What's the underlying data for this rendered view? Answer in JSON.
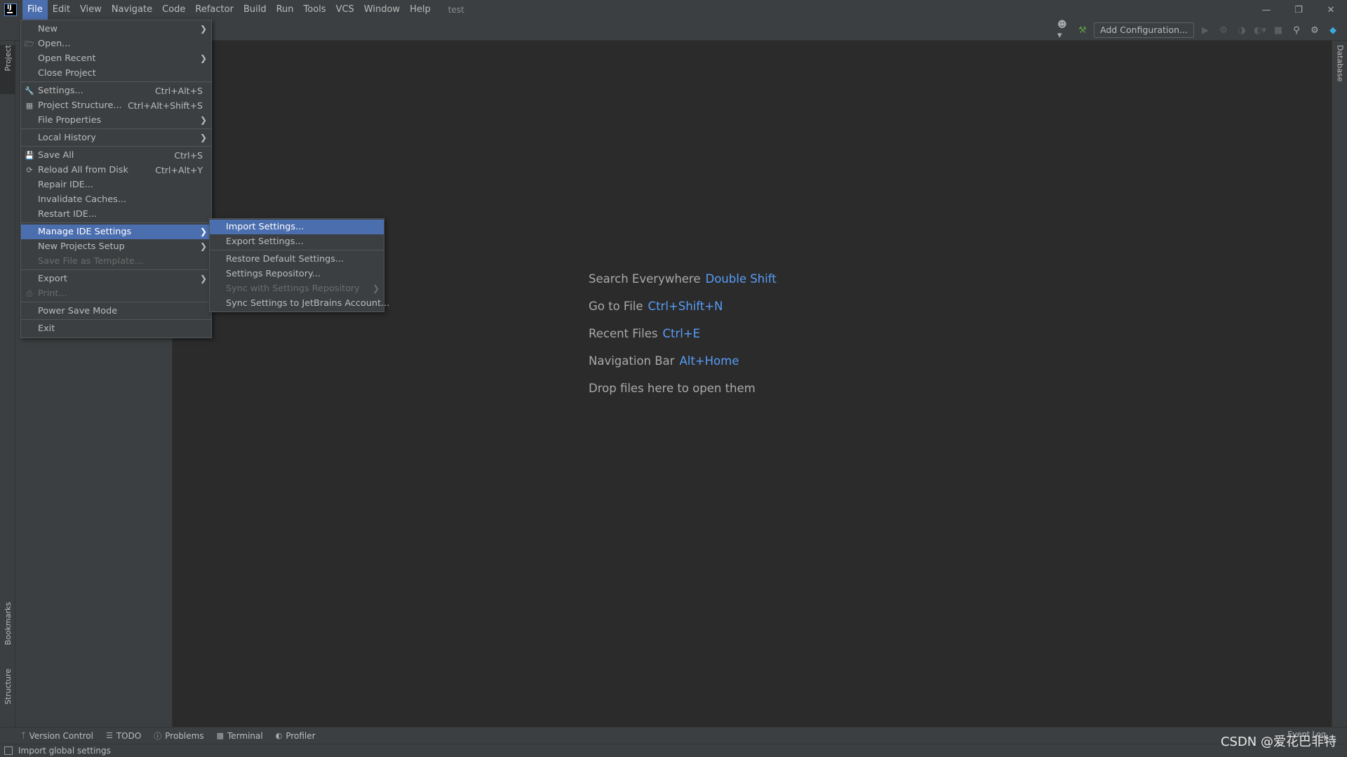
{
  "menubar": {
    "items": [
      "File",
      "Edit",
      "View",
      "Navigate",
      "Code",
      "Refactor",
      "Build",
      "Run",
      "Tools",
      "VCS",
      "Window",
      "Help"
    ],
    "project_name": "test"
  },
  "toolbar": {
    "add_configuration": "Add Configuration..."
  },
  "file_menu": {
    "items": [
      {
        "label": "New",
        "shortcut": "",
        "submenu": true
      },
      {
        "label": "Open...",
        "shortcut": ""
      },
      {
        "label": "Open Recent",
        "shortcut": "",
        "submenu": true
      },
      {
        "label": "Close Project",
        "shortcut": ""
      },
      {
        "label": "Settings...",
        "shortcut": "Ctrl+Alt+S"
      },
      {
        "label": "Project Structure...",
        "shortcut": "Ctrl+Alt+Shift+S"
      },
      {
        "label": "File Properties",
        "shortcut": "",
        "submenu": true
      },
      {
        "label": "Local History",
        "shortcut": "",
        "submenu": true
      },
      {
        "label": "Save All",
        "shortcut": "Ctrl+S"
      },
      {
        "label": "Reload All from Disk",
        "shortcut": "Ctrl+Alt+Y"
      },
      {
        "label": "Repair IDE...",
        "shortcut": ""
      },
      {
        "label": "Invalidate Caches...",
        "shortcut": ""
      },
      {
        "label": "Restart IDE...",
        "shortcut": ""
      },
      {
        "label": "Manage IDE Settings",
        "shortcut": "",
        "submenu": true,
        "highlighted": true
      },
      {
        "label": "New Projects Setup",
        "shortcut": "",
        "submenu": true
      },
      {
        "label": "Save File as Template...",
        "shortcut": "",
        "disabled": true
      },
      {
        "label": "Export",
        "shortcut": "",
        "submenu": true
      },
      {
        "label": "Print...",
        "shortcut": "",
        "disabled": true
      },
      {
        "label": "Power Save Mode",
        "shortcut": ""
      },
      {
        "label": "Exit",
        "shortcut": ""
      }
    ]
  },
  "manage_settings_submenu": {
    "items": [
      {
        "label": "Import Settings...",
        "highlighted": true
      },
      {
        "label": "Export Settings..."
      },
      {
        "label": "Restore Default Settings..."
      },
      {
        "label": "Settings Repository..."
      },
      {
        "label": "Sync with Settings Repository",
        "disabled": true
      },
      {
        "label": "Sync Settings to JetBrains Account..."
      }
    ]
  },
  "editor_hints": [
    {
      "text": "Search Everywhere",
      "key": "Double Shift"
    },
    {
      "text": "Go to File",
      "key": "Ctrl+Shift+N"
    },
    {
      "text": "Recent Files",
      "key": "Ctrl+E"
    },
    {
      "text": "Navigation Bar",
      "key": "Alt+Home"
    },
    {
      "text": "Drop files here to open them",
      "key": ""
    }
  ],
  "left_tabs": {
    "project": "Project",
    "bookmarks": "Bookmarks",
    "structure": "Structure"
  },
  "right_tabs": {
    "database": "Database"
  },
  "bottom_tabs": [
    "Version Control",
    "TODO",
    "Problems",
    "Terminal",
    "Profiler"
  ],
  "status": {
    "message": "Import global settings",
    "event_log": "Event Log",
    "watermark": "CSDN @爱花巴非特"
  },
  "colors": {
    "accent": "#4b6eaf",
    "shortcut_blue": "#589df6",
    "background": "#2b2b2b",
    "panel": "#3c3f41"
  }
}
